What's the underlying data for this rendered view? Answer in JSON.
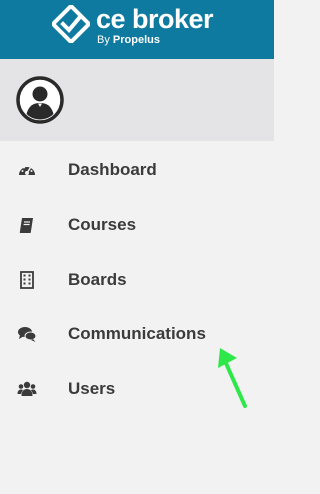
{
  "header": {
    "brand": "ce broker",
    "byline_prefix": "By",
    "byline_name": "Propelus",
    "background": "#0f7aa0",
    "logo_icon": "ce-broker-logo-icon"
  },
  "profile": {
    "avatar_icon": "user-avatar-icon"
  },
  "nav": {
    "items": [
      {
        "label": "Dashboard",
        "icon": "tachometer-icon"
      },
      {
        "label": "Courses",
        "icon": "book-icon"
      },
      {
        "label": "Boards",
        "icon": "building-icon"
      },
      {
        "label": "Communications",
        "icon": "comments-icon"
      },
      {
        "label": "Users",
        "icon": "users-icon"
      }
    ],
    "label_color": "#3b3b3b"
  },
  "annotation": {
    "arrow_color": "#2ee84a",
    "points_to": "Communications"
  }
}
